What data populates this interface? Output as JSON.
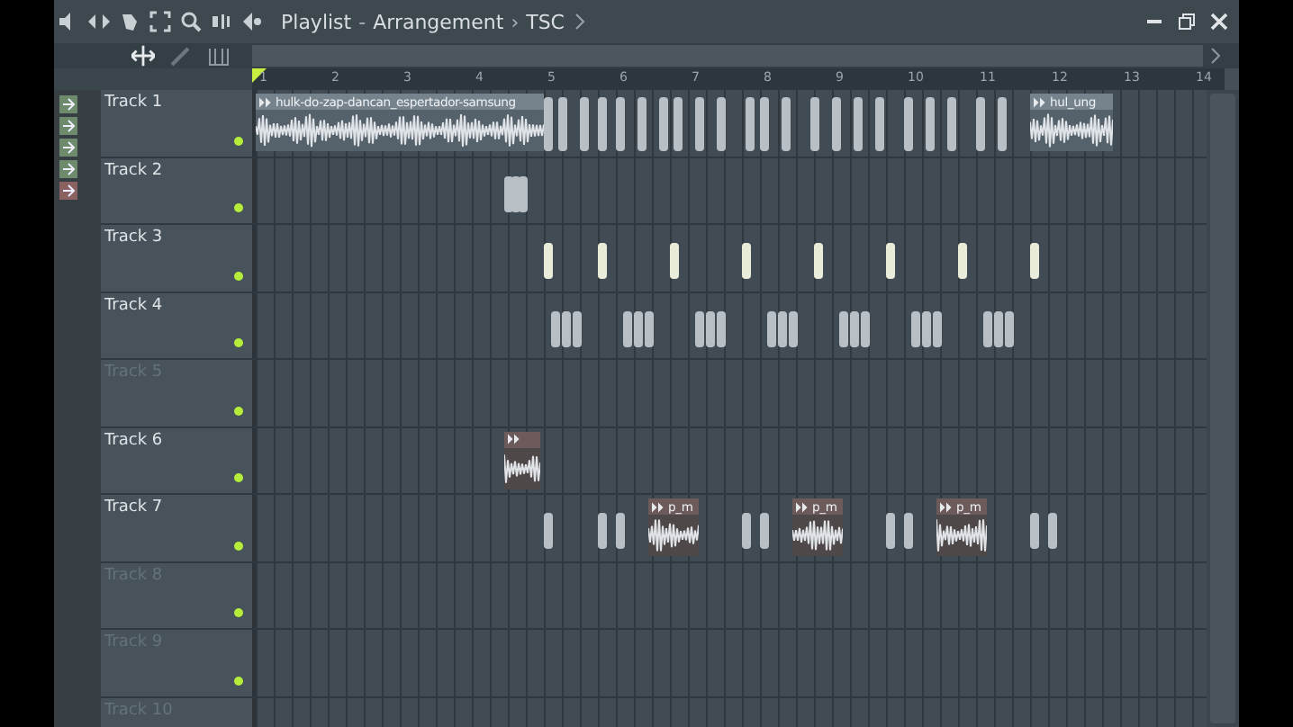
{
  "window": {
    "title": "Playlist",
    "path": [
      {
        "sep": "-",
        "text": "Arrangement"
      },
      {
        "sep": "›",
        "text": "TSC"
      }
    ]
  },
  "ruler": [
    "1",
    "2",
    "3",
    "4",
    "5",
    "6",
    "7",
    "8",
    "9",
    "10",
    "11",
    "12",
    "13",
    "14"
  ],
  "tracks": [
    {
      "name": "Track 1",
      "active": true,
      "clips": [
        {
          "label": "hulk-do-zap-dancan_espertador-samsung"
        },
        {
          "label": "hul_ung"
        }
      ]
    },
    {
      "name": "Track 2",
      "active": true
    },
    {
      "name": "Track 3",
      "active": true
    },
    {
      "name": "Track 4",
      "active": true
    },
    {
      "name": "Track 5",
      "active": false
    },
    {
      "name": "Track 6",
      "active": true
    },
    {
      "name": "Track 7",
      "active": true,
      "clips": [
        {
          "label": "p_m"
        },
        {
          "label": "p_m"
        },
        {
          "label": "p_m"
        }
      ]
    },
    {
      "name": "Track 8",
      "active": false
    },
    {
      "name": "Track 9",
      "active": false
    },
    {
      "name": "Track 10",
      "active": false
    }
  ]
}
